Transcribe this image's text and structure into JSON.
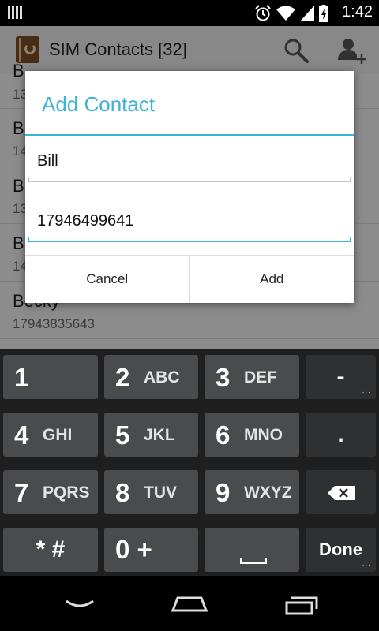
{
  "status_bar": {
    "time": "1:42",
    "icons": [
      "notification-icon",
      "alarm-icon",
      "wifi-icon",
      "signal-icon",
      "battery-icon"
    ]
  },
  "action_bar": {
    "title": "SIM Contacts [32]",
    "icons": [
      "app-icon",
      "search-icon",
      "add-contact-icon"
    ]
  },
  "contacts": [
    {
      "name": "B",
      "number": "13"
    },
    {
      "name": "B",
      "number": "14"
    },
    {
      "name": "B",
      "number": "13"
    },
    {
      "name": "B",
      "number": "14"
    },
    {
      "name": "Becky",
      "number": "17943835643"
    }
  ],
  "dialog": {
    "title": "Add Contact",
    "name_value": "Bill",
    "phone_value": "17946499641",
    "cancel_label": "Cancel",
    "add_label": "Add"
  },
  "keypad": {
    "rows": [
      [
        {
          "digit": "1",
          "letters": ""
        },
        {
          "digit": "2",
          "letters": "ABC"
        },
        {
          "digit": "3",
          "letters": "DEF"
        },
        {
          "label": "-"
        }
      ],
      [
        {
          "digit": "4",
          "letters": "GHI"
        },
        {
          "digit": "5",
          "letters": "JKL"
        },
        {
          "digit": "6",
          "letters": "MNO"
        },
        {
          "label": "."
        }
      ],
      [
        {
          "digit": "7",
          "letters": "PQRS"
        },
        {
          "digit": "8",
          "letters": "TUV"
        },
        {
          "digit": "9",
          "letters": "WXYZ"
        },
        {
          "label": "backspace-icon"
        }
      ],
      [
        {
          "label": "* #"
        },
        {
          "label": "0 +"
        },
        {
          "label": "space"
        },
        {
          "label": "Done"
        }
      ]
    ]
  },
  "nav_bar": {
    "icons": [
      "back-icon",
      "home-icon",
      "recent-apps-icon"
    ]
  },
  "colors": {
    "accent": "#3cb3d6",
    "key": "#4a4b4c",
    "key_dark": "#2f3031",
    "keypad_bg": "#1f1f1f"
  }
}
